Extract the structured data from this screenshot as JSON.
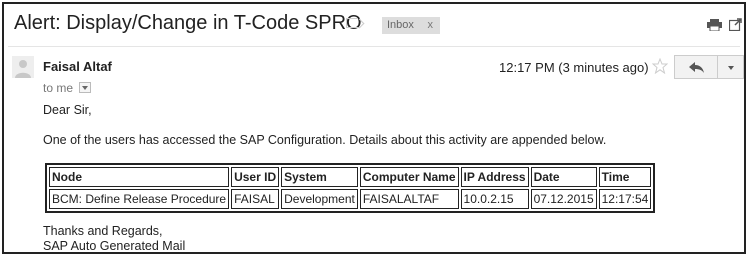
{
  "subject": "Alert: Display/Change in T-Code SPRO",
  "label": {
    "name": "Inbox",
    "remove": "x"
  },
  "icons": {
    "label": "label-important-icon",
    "print": "print-icon",
    "popout": "new-window-icon",
    "avatar": "person-avatar-icon",
    "star": "star-outline-icon",
    "reply": "reply-arrow-icon",
    "more": "chevron-down-icon"
  },
  "sender": {
    "name": "Faisal Altaf",
    "to": "to me"
  },
  "timestamp": "12:17 PM (3 minutes ago)",
  "body": {
    "greeting": "Dear Sir,",
    "intro": "One of the users has accessed the SAP Configuration. Details about this activity are appended below.",
    "sign_off_1": "Thanks and Regards,",
    "sign_off_2": "SAP Auto Generated Mail"
  },
  "table": {
    "headers": [
      "Node",
      "User ID",
      "System",
      "Computer Name",
      "IP Address",
      "Date",
      "Time"
    ],
    "rows": [
      [
        "BCM: Define Release Procedure",
        "FAISAL",
        "Development",
        "FAISALALTAF",
        "10.0.2.15",
        "07.12.2015",
        "12:17:54"
      ]
    ]
  },
  "colors": {
    "border": "#222222",
    "tag_bg": "#dddddd",
    "muted": "#777777"
  }
}
